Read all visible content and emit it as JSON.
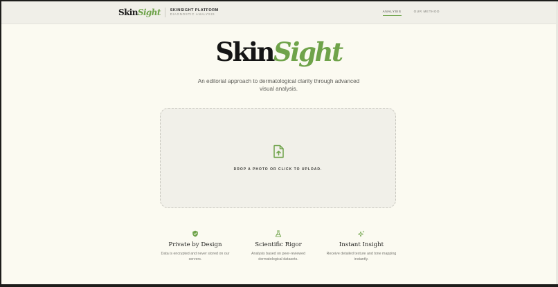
{
  "header": {
    "brand_skin": "Skin",
    "brand_sight": "Sight",
    "platform_title": "SKINSIGHT PLATFORM",
    "platform_subtitle": "DIAGNOSTIC ANALYSIS",
    "nav": [
      {
        "label": "ANALYSIS",
        "active": true
      },
      {
        "label": "OUR METHOD",
        "active": false
      }
    ]
  },
  "hero": {
    "logo_skin": "Skin",
    "logo_sight": "Sight",
    "tagline": "An editorial approach to dermatological clarity through advanced visual analysis."
  },
  "upload": {
    "icon": "file-upload-icon",
    "label": "DROP A PHOTO OR CLICK TO UPLOAD."
  },
  "features": [
    {
      "icon": "shield-check-icon",
      "title": "Private by Design",
      "description": "Data is encrypted and never stored on our servers."
    },
    {
      "icon": "flask-icon",
      "title": "Scientific Rigor",
      "description": "Analysis based on peer-reviewed dermatological datasets."
    },
    {
      "icon": "sparkles-icon",
      "title": "Instant Insight",
      "description": "Receive detailed texture and tone mapping instantly."
    }
  ],
  "colors": {
    "accent": "#6fa34a",
    "background": "#fbfaf1",
    "header": "#f0efe8",
    "upload_bg": "#f1f0e9"
  }
}
